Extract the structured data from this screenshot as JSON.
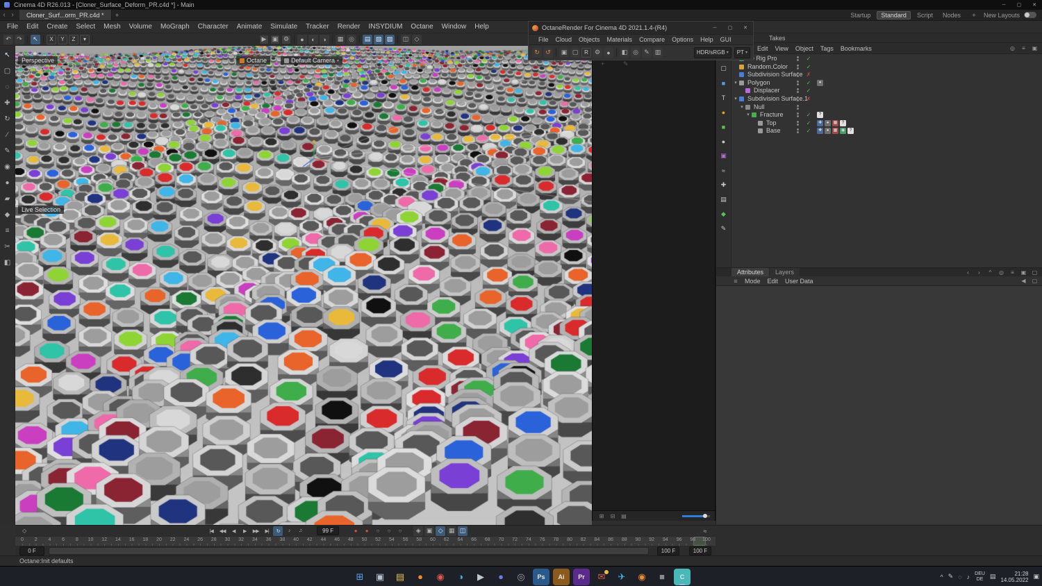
{
  "titlebar": {
    "title": "Cinema 4D R26.013 - [Cloner_Surface_Deform_PR.c4d *] - Main"
  },
  "window_controls": {
    "minimize": "─",
    "maximize": "▢",
    "close": "✕"
  },
  "tabbar": {
    "back": "‹",
    "forward": "›",
    "tab_label": "Cloner_Surf...orm_PR.c4d *",
    "add_tab": "+"
  },
  "layout_switcher": {
    "items": [
      "Startup",
      "Standard",
      "Script",
      "Nodes"
    ],
    "active": "Standard",
    "add": "+",
    "new_layouts_label": "New Layouts"
  },
  "menu_items": [
    "File",
    "Edit",
    "Create",
    "Select",
    "Mesh",
    "Volume",
    "MoGraph",
    "Character",
    "Animate",
    "Simulate",
    "Tracker",
    "Render",
    "INSYDIUM",
    "Octane",
    "Window",
    "Help"
  ],
  "main_toolbar": [
    {
      "name": "undo",
      "g": "↶"
    },
    {
      "name": "redo",
      "g": "↷"
    },
    {
      "sep": true
    },
    {
      "name": "select-tool",
      "g": "↖",
      "active": true
    },
    {
      "sep": true
    },
    {
      "name": "axis-x-lock",
      "g": "X",
      "text": true
    },
    {
      "name": "axis-y-lock",
      "g": "Y",
      "text": true
    },
    {
      "name": "axis-z-lock",
      "g": "Z",
      "text": true
    },
    {
      "name": "coordinate-system",
      "g": "▾",
      "text": true
    },
    {
      "sep": true
    },
    {
      "name": "render-view",
      "g": "▶",
      "ml": 236,
      "box": true
    },
    {
      "name": "render-picture-viewer",
      "g": "▣",
      "box": true
    },
    {
      "name": "render-settings",
      "g": "⚙",
      "box": true
    },
    {
      "sep": true
    },
    {
      "name": "new-material",
      "g": "●"
    },
    {
      "name": "material-mode",
      "g": "◐"
    },
    {
      "name": "environment",
      "g": "◑"
    },
    {
      "sep": true
    },
    {
      "name": "floor",
      "g": "▦"
    },
    {
      "name": "camera",
      "g": "◎"
    },
    {
      "sep": true
    },
    {
      "name": "display-mode-1",
      "g": "▤",
      "active": true
    },
    {
      "name": "display-mode-2",
      "g": "▧",
      "active": true
    },
    {
      "name": "display-mode-3",
      "g": "▨",
      "active": true
    },
    {
      "sep": true
    },
    {
      "name": "workplane",
      "g": "◫"
    },
    {
      "name": "snap-settings",
      "g": "◇"
    }
  ],
  "left_toolbar": [
    {
      "name": "live-selection-tool",
      "g": "↖",
      "active": true
    },
    {
      "name": "rectangle-selection",
      "g": "▢"
    },
    {
      "name": "lasso-selection",
      "g": "◌"
    },
    {
      "name": "move-tool",
      "g": "✚"
    },
    {
      "name": "rotate-tool",
      "g": "↻"
    },
    {
      "name": "knife-tool",
      "g": "∕"
    },
    {
      "name": "pen-tool",
      "g": "✎"
    },
    {
      "name": "eyedropper-tool",
      "g": "◉"
    },
    {
      "name": "brush-tool",
      "g": "●"
    },
    {
      "name": "stamp-tool",
      "g": "▰"
    },
    {
      "name": "smudge-tool",
      "g": "◆"
    },
    {
      "name": "comb-tool",
      "g": "≡"
    },
    {
      "name": "scissors-tool",
      "g": "✂"
    },
    {
      "name": "mirror-tool",
      "g": "◧"
    }
  ],
  "viewport": {
    "view_label": "Perspective",
    "camera_hud": "Octane",
    "default_camera_hud": "Default Camera",
    "tool_hint": "Live Selection",
    "palette": [
      "#d92b2b",
      "#e8642a",
      "#e8b93a",
      "#8fd435",
      "#3fae4a",
      "#1a7a33",
      "#2fc4a8",
      "#3fb5e8",
      "#2a62d9",
      "#20337f",
      "#7a3fd4",
      "#c93fc0",
      "#ef6aa8",
      "#8a2433",
      "#101010",
      "#2e2e2e",
      "#d8d8d8"
    ]
  },
  "octane": {
    "title": "OctaneRender For Cinema 4D 2021.1.4-(R4)",
    "menu": [
      "File",
      "Cloud",
      "Objects",
      "Materials",
      "Compare",
      "Options",
      "Help",
      "GUI"
    ],
    "toolbar": [
      {
        "name": "restart-render",
        "g": "↻",
        "c": "#e08a3a"
      },
      {
        "name": "pause-render",
        "g": "↺",
        "c": "#e08a3a"
      },
      {
        "sep": true
      },
      {
        "name": "lock-resolution",
        "g": "▣"
      },
      {
        "name": "render-region",
        "g": "▢"
      },
      {
        "name": "recompile",
        "g": "R",
        "text": true
      },
      {
        "name": "kernel-settings",
        "g": "⚙"
      },
      {
        "name": "clay-mode",
        "g": "●"
      },
      {
        "sep": true
      },
      {
        "name": "pick-material",
        "g": "◧"
      },
      {
        "name": "pick-focus",
        "g": "◎"
      },
      {
        "name": "white-balance",
        "g": "✎"
      },
      {
        "name": "save-image",
        "g": "▥"
      }
    ],
    "colorspace": "HDR/sRGB",
    "render_mode": "PT",
    "dd_arrow": "▾",
    "corner_add": "+",
    "corner_pen": "✎",
    "bottom_icons": [
      {
        "name": "layout-grid-1",
        "g": "⊞"
      },
      {
        "name": "layout-grid-2",
        "g": "⊟"
      },
      {
        "name": "layout-grid-3",
        "g": "▤"
      }
    ]
  },
  "object_manager": {
    "takes_label": "Takes",
    "menu": [
      "Edit",
      "View",
      "Object",
      "Tags",
      "Bookmarks"
    ],
    "om_tools": [
      {
        "name": "om-search",
        "g": "◎"
      },
      {
        "name": "om-filter",
        "g": "≡"
      },
      {
        "name": "om-lock",
        "g": "▣"
      }
    ],
    "palette": [
      {
        "name": "layout-square",
        "g": "▢",
        "c": "#c8c8c8"
      },
      {
        "name": "cube-object",
        "g": "■",
        "c": "#5a9ae0"
      },
      {
        "name": "text-object",
        "g": "T",
        "c": "#c8c8c8"
      },
      {
        "name": "material-ball",
        "g": "●",
        "c": "#e0a030"
      },
      {
        "name": "mograph-cube",
        "g": "■",
        "c": "#57c057"
      },
      {
        "name": "sphere-object",
        "g": "●",
        "c": "#c8c8c8"
      },
      {
        "name": "tag",
        "g": "▣",
        "c": "#b070d0"
      },
      {
        "name": "spline",
        "g": "≈",
        "c": "#c8c8c8"
      },
      {
        "name": "axis",
        "g": "✚",
        "c": "#c8c8c8"
      },
      {
        "name": "layout-rows",
        "g": "▤",
        "c": "#c8c8c8"
      },
      {
        "name": "mograph-diamond",
        "g": "◆",
        "c": "#57c057"
      },
      {
        "name": "pen",
        "g": "✎",
        "c": "#c8c8c8"
      }
    ],
    "tag_styles": {
      "phong": {
        "bg": "#6e6e6e",
        "g": "●"
      },
      "question": {
        "bg": "#e0e0e0",
        "g": "?",
        "fg": "#222"
      },
      "axis": {
        "bg": "#4a6a9c",
        "g": "✚"
      },
      "texture": {
        "bg": "#9c4a4a",
        "g": "▦"
      },
      "display": {
        "bg": "#4a9c6a",
        "g": "◉"
      }
    },
    "items": [
      {
        "label": "ne Rig Pro",
        "depth": 1,
        "icon_color": "#49b04f",
        "arrow": "",
        "state": "check",
        "layer_dot": "#49b04f",
        "tags": []
      },
      {
        "label": "Random.Color",
        "depth": 1,
        "icon_color": "#d8a43a",
        "arrow": "",
        "state": "check",
        "tags": []
      },
      {
        "label": "Subdivision Surface",
        "depth": 1,
        "icon_color": "#4a7fd8",
        "arrow": "",
        "state": "cross",
        "tags": []
      },
      {
        "label": "Polygon",
        "depth": 1,
        "icon_color": "#9a9a9a",
        "arrow": "▾",
        "state": "check",
        "tags": [
          "phong"
        ]
      },
      {
        "label": "Displacer",
        "depth": 2,
        "icon_color": "#b56ad8",
        "arrow": "",
        "state": "check",
        "tags": []
      },
      {
        "label": "Subdivision Surface.1",
        "depth": 1,
        "icon_color": "#4a7fd8",
        "arrow": "▾",
        "state": "cross",
        "tags": []
      },
      {
        "label": "Null",
        "depth": 2,
        "icon_color": "#8a8a8a",
        "arrow": "▾",
        "state": "none",
        "tags": []
      },
      {
        "label": "Fracture",
        "depth": 3,
        "icon_color": "#49b04f",
        "arrow": "▾",
        "state": "check",
        "tags": [
          "question"
        ]
      },
      {
        "label": "Top",
        "depth": 4,
        "icon_color": "#9a9a9a",
        "arrow": "",
        "state": "check",
        "tags": [
          "axis",
          "phong",
          "texture",
          "question"
        ]
      },
      {
        "label": "Base",
        "depth": 4,
        "icon_color": "#9a9a9a",
        "arrow": "",
        "state": "check",
        "tags": [
          "axis",
          "phong",
          "texture",
          "display",
          "question"
        ]
      }
    ]
  },
  "attributes": {
    "tabs": [
      "Attributes",
      "Layers"
    ],
    "active_tab": "Attributes",
    "burger": "≡",
    "mode_menu": [
      "Mode",
      "Edit",
      "User Data"
    ],
    "toolbar": [
      {
        "name": "attr-back",
        "g": "‹"
      },
      {
        "name": "attr-forward",
        "g": "›"
      },
      {
        "name": "attr-up",
        "g": "^"
      },
      {
        "name": "attr-search",
        "g": "◎"
      },
      {
        "name": "attr-filter",
        "g": "≡"
      },
      {
        "name": "attr-lock",
        "g": "▣"
      },
      {
        "name": "attr-float",
        "g": "▢"
      }
    ],
    "mode_right": [
      {
        "name": "attr-arrow-left",
        "g": "◀"
      },
      {
        "name": "attr-panel",
        "g": "▢"
      }
    ]
  },
  "timeline": {
    "keyframe_diamond": "◇",
    "transport": [
      {
        "name": "goto-start",
        "g": "|◀"
      },
      {
        "name": "prev-key",
        "g": "◀◀"
      },
      {
        "name": "prev-frame",
        "g": "◀"
      },
      {
        "name": "play",
        "g": "▶"
      },
      {
        "name": "next-frame",
        "g": "▶▶"
      },
      {
        "name": "goto-end",
        "g": "▶|"
      },
      {
        "name": "loop-playback",
        "g": "↻",
        "active": true
      },
      {
        "name": "play-sound",
        "g": "♪"
      },
      {
        "name": "volume",
        "g": "♫"
      }
    ],
    "record": [
      {
        "name": "record-keyframe",
        "g": "●",
        "c": "#d25046"
      },
      {
        "name": "autokeying",
        "g": "●",
        "c": "#d25046"
      },
      {
        "name": "record-position",
        "g": "○",
        "c": "#9a9a9a"
      },
      {
        "name": "record-scale",
        "g": "○",
        "c": "#9a9a9a"
      },
      {
        "name": "record-rotation",
        "g": "○",
        "c": "#9a9a9a"
      }
    ],
    "options": [
      {
        "name": "keyframe-selection",
        "g": "◈"
      },
      {
        "name": "keying-settings",
        "g": "▣"
      },
      {
        "name": "snap-toggle",
        "g": "◇",
        "active": true
      },
      {
        "name": "quantize-toggle",
        "g": "▦"
      },
      {
        "name": "pla-toggle",
        "g": "◫",
        "active": true
      }
    ],
    "fcurve_icon": "≈",
    "current_frame": "99 F",
    "range_start": "0 F",
    "range_end": "100 F",
    "range_end_2": "100 F",
    "ruler_max": 100,
    "ruler_step": 2,
    "marker_frame": 99
  },
  "status_message": "Octane:Init defaults",
  "taskbar": {
    "apps": [
      {
        "name": "start-button",
        "g": "⊞",
        "c": "#5aa2f0"
      },
      {
        "name": "task-view",
        "g": "▣",
        "c": "#b8c2cc"
      },
      {
        "name": "file-explorer",
        "g": "▤",
        "c": "#e8c04a"
      },
      {
        "name": "firefox",
        "g": "●",
        "c": "#f08a2a"
      },
      {
        "name": "chrome",
        "g": "◉",
        "c": "#e0554a"
      },
      {
        "name": "edge",
        "g": "◑",
        "c": "#3ab5e8"
      },
      {
        "name": "media-app",
        "g": "▶",
        "c": "#c0c8d0"
      },
      {
        "name": "discord",
        "g": "●",
        "c": "#6a7ae8"
      },
      {
        "name": "obs",
        "g": "◎",
        "c": "#9aa2aa"
      },
      {
        "name": "photoshop",
        "g": "Ps",
        "c": "#2a5a8c",
        "text": true
      },
      {
        "name": "illustrator",
        "g": "Ai",
        "c": "#8c5a1a",
        "text": true
      },
      {
        "name": "premiere",
        "g": "Pr",
        "c": "#5a2a8c",
        "text": true
      },
      {
        "name": "mail",
        "g": "✉",
        "c": "#e05a4a",
        "badge": true
      },
      {
        "name": "telegram",
        "g": "✈",
        "c": "#3ab5e8"
      },
      {
        "name": "blender",
        "g": "◉",
        "c": "#f08a2a"
      },
      {
        "name": "zbrush",
        "g": "■",
        "c": "#8a8a8a"
      },
      {
        "name": "cinema4d",
        "g": "C",
        "c": "#4ab8b8",
        "text": true,
        "active": true
      }
    ],
    "tray_icons": [
      {
        "name": "tray-chevron",
        "g": "^"
      },
      {
        "name": "tray-pen",
        "g": "✎"
      },
      {
        "name": "tray-cloud",
        "g": "◌"
      },
      {
        "name": "tray-volume",
        "g": "♪"
      }
    ],
    "keyboard_glyph": "▤",
    "notification_glyph": "▣",
    "language": {
      "line1": "DEU",
      "line2": "DE"
    },
    "clock": {
      "time": "21:28",
      "date": "14.05.2022"
    }
  }
}
